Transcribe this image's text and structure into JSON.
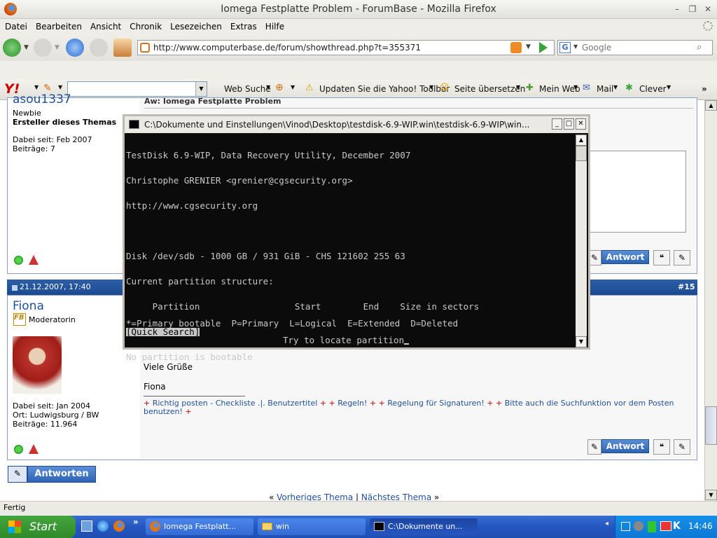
{
  "window": {
    "title": "Iomega Festplatte Problem - ForumBase - Mozilla Firefox"
  },
  "menu": [
    "Datei",
    "Bearbeiten",
    "Ansicht",
    "Chronik",
    "Lesezeichen",
    "Extras",
    "Hilfe"
  ],
  "nav": {
    "url": "http://www.computerbase.de/forum/showthread.php?t=355371",
    "search_placeholder": "Google",
    "search_engine": "G"
  },
  "yahoo": {
    "logo": "Y!",
    "web_search": "Web Suche",
    "update": "Updaten Sie die Yahoo! Toolbar",
    "translate": "Seite übersetzen",
    "my_web": "Mein Web",
    "mail": "Mail",
    "clever": "Clever"
  },
  "post1": {
    "username": "asou1337",
    "rank": "Newbie",
    "role": "Ersteller dieses Themas",
    "joined": "Dabei seit: Feb 2007",
    "posts": "Beiträge: 7",
    "subject": "Aw: Iomega Festplatte Problem",
    "reply": "Antwort"
  },
  "post2": {
    "date": "21.12.2007, 17:40",
    "number": "#15",
    "username": "Fiona",
    "rank_badge": "FB",
    "rank": "Moderatorin",
    "joined": "Dabei seit: Jan 2004",
    "location": "Ort: Ludwigsburg / BW",
    "posts": "Beiträge: 11.964",
    "greeting": "Viele Grüße",
    "signature_name": "Fiona",
    "sig_line1": "Richtig posten - Checkliste .|. Benutzertitel",
    "sig_rules": "Regeln!",
    "sig_sign": "Regelung für Signaturen!",
    "sig_search": "Bitte auch die Suchfunktion vor dem Posten benutzen!",
    "reply": "Antwort"
  },
  "reply_button": "Antworten",
  "thread_nav": {
    "prev": "Vorheriges Thema",
    "sep": "|",
    "next": "Nächstes Thema"
  },
  "status": "Fertig",
  "console": {
    "title": "C:\\Dokumente und Einstellungen\\Vinod\\Desktop\\testdisk-6.9-WIP.win\\testdisk-6.9-WIP\\win...",
    "lines": [
      "TestDisk 6.9-WIP, Data Recovery Utility, December 2007",
      "Christophe GRENIER <grenier@cgsecurity.org>",
      "http://www.cgsecurity.org",
      "",
      "Disk /dev/sdb - 1000 GB / 931 GiB - CHS 121602 255 63",
      "Current partition structure:",
      "     Partition                  Start        End    Size in sectors",
      "",
      "No partition is bootable"
    ],
    "legend": "*=Primary bootable  P=Primary  L=Logical  E=Extended  D=Deleted",
    "quick_search": "[Quick Search]",
    "prompt": "Try to locate partition"
  },
  "taskbar": {
    "start": "Start",
    "tasks": [
      "Iomega Festplatt...",
      "win",
      "C:\\Dokumente un..."
    ],
    "clock": "14:46"
  }
}
